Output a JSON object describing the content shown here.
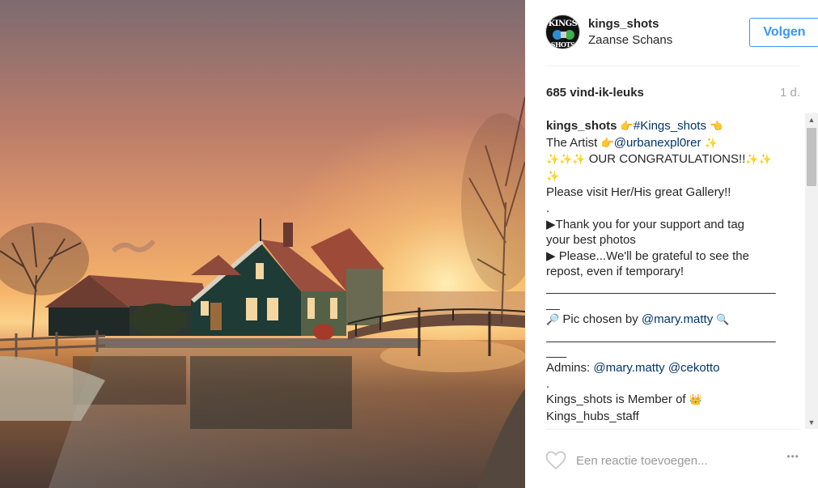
{
  "post": {
    "image_alt": "Zaanse Schans houses at sunset",
    "header": {
      "avatar_text_top": "KINGS",
      "avatar_text_bottom": "SHOTS",
      "username": "kings_shots",
      "location": "Zaanse Schans",
      "follow_label": "Volgen"
    },
    "meta": {
      "likes": "685 vind-ik-leuks",
      "time": "1 d."
    },
    "caption": {
      "user": "kings_shots",
      "hashtag": "#Kings_shots",
      "artist_prefix": "The Artist",
      "artist_handle": "@urbanexpl0rer",
      "congrats": "OUR CONGRATULATIONS!!",
      "visit": "Please visit Her/His great Gallery!!",
      "dot1": ".",
      "thanks_1": "▶Thank you for your support and tag",
      "thanks_2": "your best photos",
      "please_1": "▶ Please...We'll be grateful to see the",
      "please_2": "repost, even if temporary!",
      "divider_1a": "__________________________________",
      "divider_1b": "__",
      "pic_prefix": "Pic chosen by",
      "pic_handle": "@mary.matty",
      "divider_2a": "__________________________________",
      "divider_2b": "___",
      "admins_prefix": "Admins:",
      "admin_1": "@mary.matty",
      "admin_2": "@cekotto",
      "dot2": ".",
      "member_1": "Kings_shots is Member of",
      "member_2": "Kings_hubs_staff"
    },
    "icons": {
      "pointing_right": "👉",
      "pointing_left": "👈",
      "sparkles": "✨",
      "magnifier_left": "🔎",
      "magnifier_right": "🔍",
      "crown": "👑",
      "heart": "heart-icon",
      "more": "more-options-icon"
    },
    "footer": {
      "comment_placeholder": "Een reactie toevoegen...",
      "more_label": "•••"
    }
  },
  "colors": {
    "follow_blue": "#3897f0",
    "link_blue": "#003569",
    "muted": "#a5a7aa"
  }
}
